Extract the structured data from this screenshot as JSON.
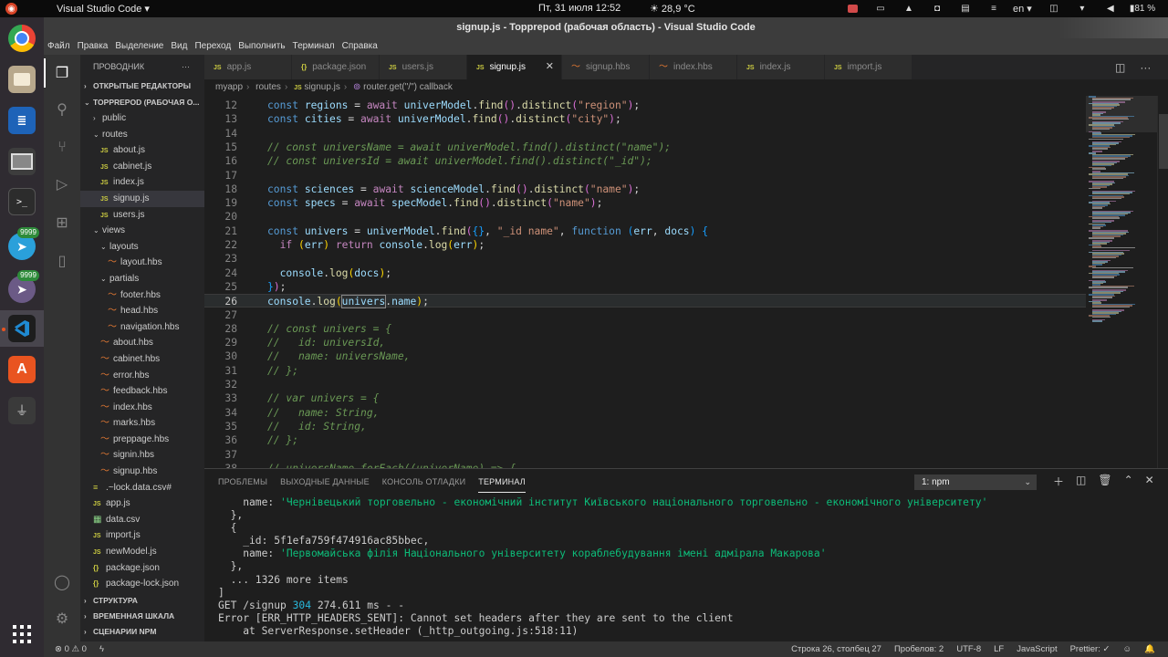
{
  "system": {
    "app_menu": "Visual Studio Code ▾",
    "clock": "Пт, 31 июля  12:52",
    "weather": "28,9 °C",
    "lang": "en ▾",
    "battery": "81 %"
  },
  "dock": {
    "badge1": "9999",
    "badge2": "9999"
  },
  "window": {
    "title": "signup.js - Topprepod (рабочая область) - Visual Studio Code"
  },
  "menu": [
    "Файл",
    "Правка",
    "Выделение",
    "Вид",
    "Переход",
    "Выполнить",
    "Терминал",
    "Справка"
  ],
  "sidebar": {
    "title": "ПРОВОДНИК",
    "more": "···",
    "open_editors": "ОТКРЫТЫЕ РЕДАКТОРЫ",
    "workspace": "TOPPREPOD (РАБОЧАЯ О...",
    "tree": [
      {
        "label": "public",
        "kind": "folder-closed",
        "indent": 1
      },
      {
        "label": "routes",
        "kind": "folder-open",
        "indent": 1
      },
      {
        "label": "about.js",
        "kind": "js",
        "indent": 2
      },
      {
        "label": "cabinet.js",
        "kind": "js",
        "indent": 2
      },
      {
        "label": "index.js",
        "kind": "js",
        "indent": 2
      },
      {
        "label": "signup.js",
        "kind": "js",
        "indent": 2,
        "selected": true
      },
      {
        "label": "users.js",
        "kind": "js",
        "indent": 2
      },
      {
        "label": "views",
        "kind": "folder-open",
        "indent": 1
      },
      {
        "label": "layouts",
        "kind": "folder-open",
        "indent": 2
      },
      {
        "label": "layout.hbs",
        "kind": "hbs",
        "indent": 3
      },
      {
        "label": "partials",
        "kind": "folder-open",
        "indent": 2
      },
      {
        "label": "footer.hbs",
        "kind": "hbs",
        "indent": 3
      },
      {
        "label": "head.hbs",
        "kind": "hbs",
        "indent": 3
      },
      {
        "label": "navigation.hbs",
        "kind": "hbs",
        "indent": 3
      },
      {
        "label": "about.hbs",
        "kind": "hbs",
        "indent": 2
      },
      {
        "label": "cabinet.hbs",
        "kind": "hbs",
        "indent": 2
      },
      {
        "label": "error.hbs",
        "kind": "hbs",
        "indent": 2
      },
      {
        "label": "feedback.hbs",
        "kind": "hbs",
        "indent": 2
      },
      {
        "label": "index.hbs",
        "kind": "hbs",
        "indent": 2
      },
      {
        "label": "marks.hbs",
        "kind": "hbs",
        "indent": 2
      },
      {
        "label": "preppage.hbs",
        "kind": "hbs",
        "indent": 2
      },
      {
        "label": "signin.hbs",
        "kind": "hbs",
        "indent": 2
      },
      {
        "label": "signup.hbs",
        "kind": "hbs",
        "indent": 2
      },
      {
        "label": ".~lock.data.csv#",
        "kind": "lock",
        "indent": 1
      },
      {
        "label": "app.js",
        "kind": "js",
        "indent": 1
      },
      {
        "label": "data.csv",
        "kind": "csv",
        "indent": 1
      },
      {
        "label": "import.js",
        "kind": "js",
        "indent": 1
      },
      {
        "label": "newModel.js",
        "kind": "js",
        "indent": 1
      },
      {
        "label": "package.json",
        "kind": "json",
        "indent": 1
      },
      {
        "label": "package-lock.json",
        "kind": "json",
        "indent": 1
      }
    ],
    "outline": "СТРУКТУРА",
    "timeline": "ВРЕМЕННАЯ ШКАЛА",
    "npm": "СЦЕНАРИИ NPM"
  },
  "tabs": [
    {
      "label": "app.js",
      "kind": "js"
    },
    {
      "label": "package.json",
      "kind": "json"
    },
    {
      "label": "users.js",
      "kind": "js"
    },
    {
      "label": "signup.js",
      "kind": "js",
      "active": true
    },
    {
      "label": "signup.hbs",
      "kind": "hbs"
    },
    {
      "label": "index.hbs",
      "kind": "hbs"
    },
    {
      "label": "index.js",
      "kind": "js"
    },
    {
      "label": "import.js",
      "kind": "js"
    }
  ],
  "breadcrumb": {
    "parts": [
      "myapp",
      "routes",
      "signup.js",
      "router.get(\"/\") callback"
    ]
  },
  "editor": {
    "current_line": 26,
    "lines": [
      {
        "n": 12,
        "t": [
          [
            "kw",
            "const "
          ],
          [
            "var",
            "regions"
          ],
          [
            "pn",
            " = "
          ],
          [
            "ctl",
            "await "
          ],
          [
            "var",
            "univerModel"
          ],
          [
            "pn",
            "."
          ],
          [
            "fn",
            "find"
          ],
          [
            "br2",
            "()"
          ],
          [
            "pn",
            "."
          ],
          [
            "fn",
            "distinct"
          ],
          [
            "br2",
            "("
          ],
          [
            "str",
            "\"region\""
          ],
          [
            "br2",
            ")"
          ],
          [
            "pn",
            ";"
          ]
        ]
      },
      {
        "n": 13,
        "t": [
          [
            "kw",
            "const "
          ],
          [
            "var",
            "cities"
          ],
          [
            "pn",
            " = "
          ],
          [
            "ctl",
            "await "
          ],
          [
            "var",
            "univerModel"
          ],
          [
            "pn",
            "."
          ],
          [
            "fn",
            "find"
          ],
          [
            "br2",
            "()"
          ],
          [
            "pn",
            "."
          ],
          [
            "fn",
            "distinct"
          ],
          [
            "br2",
            "("
          ],
          [
            "str",
            "\"city\""
          ],
          [
            "br2",
            ")"
          ],
          [
            "pn",
            ";"
          ]
        ]
      },
      {
        "n": 14,
        "t": []
      },
      {
        "n": 15,
        "t": [
          [
            "cm",
            "// const universName = await univerModel.find().distinct(\"name\");"
          ]
        ]
      },
      {
        "n": 16,
        "t": [
          [
            "cm",
            "// const universId = await univerModel.find().distinct(\"_id\");"
          ]
        ]
      },
      {
        "n": 17,
        "t": []
      },
      {
        "n": 18,
        "t": [
          [
            "kw",
            "const "
          ],
          [
            "var",
            "sciences"
          ],
          [
            "pn",
            " = "
          ],
          [
            "ctl",
            "await "
          ],
          [
            "var",
            "scienceModel"
          ],
          [
            "pn",
            "."
          ],
          [
            "fn",
            "find"
          ],
          [
            "br2",
            "()"
          ],
          [
            "pn",
            "."
          ],
          [
            "fn",
            "distinct"
          ],
          [
            "br2",
            "("
          ],
          [
            "str",
            "\"name\""
          ],
          [
            "br2",
            ")"
          ],
          [
            "pn",
            ";"
          ]
        ]
      },
      {
        "n": 19,
        "t": [
          [
            "kw",
            "const "
          ],
          [
            "var",
            "specs"
          ],
          [
            "pn",
            " = "
          ],
          [
            "ctl",
            "await "
          ],
          [
            "var",
            "specModel"
          ],
          [
            "pn",
            "."
          ],
          [
            "fn",
            "find"
          ],
          [
            "br2",
            "()"
          ],
          [
            "pn",
            "."
          ],
          [
            "fn",
            "distinct"
          ],
          [
            "br2",
            "("
          ],
          [
            "str",
            "\"name\""
          ],
          [
            "br2",
            ")"
          ],
          [
            "pn",
            ";"
          ]
        ]
      },
      {
        "n": 20,
        "t": []
      },
      {
        "n": 21,
        "t": [
          [
            "kw",
            "const "
          ],
          [
            "var",
            "univers"
          ],
          [
            "pn",
            " = "
          ],
          [
            "var",
            "univerModel"
          ],
          [
            "pn",
            "."
          ],
          [
            "fn",
            "find"
          ],
          [
            "br2",
            "("
          ],
          [
            "br3",
            "{}"
          ],
          [
            "pn",
            ", "
          ],
          [
            "str",
            "\"_id name\""
          ],
          [
            "pn",
            ", "
          ],
          [
            "kw",
            "function "
          ],
          [
            "br3",
            "("
          ],
          [
            "var",
            "err"
          ],
          [
            "pn",
            ", "
          ],
          [
            "var",
            "docs"
          ],
          [
            "br3",
            ")"
          ],
          [
            "pn",
            " "
          ],
          [
            "br3",
            "{"
          ]
        ]
      },
      {
        "n": 22,
        "t": [
          [
            "pn",
            "  "
          ],
          [
            "ctl",
            "if "
          ],
          [
            "br",
            "("
          ],
          [
            "var",
            "err"
          ],
          [
            "br",
            ")"
          ],
          [
            "pn",
            " "
          ],
          [
            "ctl",
            "return "
          ],
          [
            "var",
            "console"
          ],
          [
            "pn",
            "."
          ],
          [
            "fn",
            "log"
          ],
          [
            "br",
            "("
          ],
          [
            "var",
            "err"
          ],
          [
            "br",
            ")"
          ],
          [
            "pn",
            ";"
          ]
        ]
      },
      {
        "n": 23,
        "t": []
      },
      {
        "n": 24,
        "t": [
          [
            "pn",
            "  "
          ],
          [
            "var",
            "console"
          ],
          [
            "pn",
            "."
          ],
          [
            "fn",
            "log"
          ],
          [
            "br",
            "("
          ],
          [
            "var",
            "docs"
          ],
          [
            "br",
            ")"
          ],
          [
            "pn",
            ";"
          ]
        ]
      },
      {
        "n": 25,
        "t": [
          [
            "br3",
            "}"
          ],
          [
            "br2",
            ")"
          ],
          [
            "pn",
            ";"
          ]
        ]
      },
      {
        "n": 26,
        "t": [
          [
            "var",
            "console"
          ],
          [
            "pn",
            "."
          ],
          [
            "fn",
            "log"
          ],
          [
            "br",
            "("
          ],
          [
            "var",
            "univers"
          ],
          [
            "pn",
            "."
          ],
          [
            "var",
            "name"
          ],
          [
            "br",
            ")"
          ],
          [
            "pn",
            ";"
          ]
        ]
      },
      {
        "n": 27,
        "t": []
      },
      {
        "n": 28,
        "t": [
          [
            "cm",
            "// const univers = {"
          ]
        ]
      },
      {
        "n": 29,
        "t": [
          [
            "cm",
            "//   id: universId,"
          ]
        ]
      },
      {
        "n": 30,
        "t": [
          [
            "cm",
            "//   name: universName,"
          ]
        ]
      },
      {
        "n": 31,
        "t": [
          [
            "cm",
            "// };"
          ]
        ]
      },
      {
        "n": 32,
        "t": []
      },
      {
        "n": 33,
        "t": [
          [
            "cm",
            "// var univers = {"
          ]
        ]
      },
      {
        "n": 34,
        "t": [
          [
            "cm",
            "//   name: String,"
          ]
        ]
      },
      {
        "n": 35,
        "t": [
          [
            "cm",
            "//   id: String,"
          ]
        ]
      },
      {
        "n": 36,
        "t": [
          [
            "cm",
            "// };"
          ]
        ]
      },
      {
        "n": 37,
        "t": []
      },
      {
        "n": 38,
        "t": [
          [
            "cm",
            "// universName.forEach((univerName) => {"
          ]
        ]
      }
    ]
  },
  "panel": {
    "tabs": [
      "ПРОБЛЕМЫ",
      "ВЫХОДНЫЕ ДАННЫЕ",
      "КОНСОЛЬ ОТЛАДКИ",
      "ТЕРМИНАЛ"
    ],
    "active_tab": "ТЕРМИНАЛ",
    "terminal_select": "1: npm",
    "terminal": [
      [
        [
          "t-key",
          "    name: "
        ],
        [
          "t-str",
          "'Чернівецький торговельно - економічний інститут Київського національного торговельно - економічного університету'"
        ]
      ],
      [
        [
          "t-key",
          "  },"
        ]
      ],
      [
        [
          "t-key",
          "  {"
        ]
      ],
      [
        [
          "t-key",
          "    _id: 5f1efa759f474916ac85bbec,"
        ]
      ],
      [
        [
          "t-key",
          "    name: "
        ],
        [
          "t-str",
          "'Первомайська філія Національного університету кораблебудування імені адмірала Макарова'"
        ]
      ],
      [
        [
          "t-key",
          "  },"
        ]
      ],
      [
        [
          "t-key",
          "  ... 1326 more items"
        ]
      ],
      [
        [
          "t-key",
          "]"
        ]
      ],
      [
        [
          "t-key",
          "GET /signup "
        ],
        [
          "t-cyan",
          "304"
        ],
        [
          "t-key",
          " 274.611 ms - -"
        ]
      ],
      [
        [
          "t-key",
          "Error [ERR_HTTP_HEADERS_SENT]: Cannot set headers after they are sent to the client"
        ]
      ],
      [
        [
          "t-key",
          "    at ServerResponse.setHeader (_http_outgoing.js:518:11)"
        ]
      ]
    ]
  },
  "status": {
    "errors": "⊗ 0",
    "warnings": "⚠ 0",
    "line_col": "Строка 26, столбец 27",
    "spaces": "Пробелов: 2",
    "encoding": "UTF-8",
    "eol": "LF",
    "language": "JavaScript",
    "prettier": "Prettier: ✓"
  }
}
